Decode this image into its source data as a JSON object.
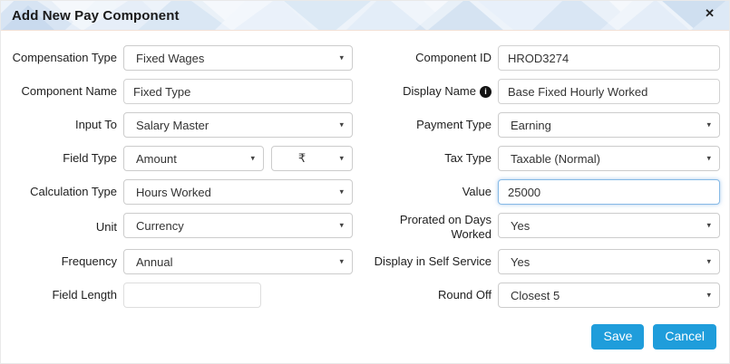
{
  "modal": {
    "title": "Add New Pay Component",
    "close_icon": "✕"
  },
  "icons": {
    "dropdown_caret": "▾",
    "info": "i"
  },
  "form": {
    "left": [
      {
        "label": "Compensation Type",
        "value": "Fixed Wages",
        "type": "select"
      },
      {
        "label": "Component Name",
        "value": "Fixed Type",
        "type": "input"
      },
      {
        "label": "Input To",
        "value": "Salary Master",
        "type": "select"
      },
      {
        "label": "Field Type",
        "value": "Amount",
        "value2": "₹",
        "type": "select-pair"
      },
      {
        "label": "Calculation Type",
        "value": "Hours Worked",
        "type": "select"
      },
      {
        "label": "Unit",
        "value": "Currency",
        "type": "select"
      },
      {
        "label": "Frequency",
        "value": "Annual",
        "type": "select"
      },
      {
        "label": "Field Length",
        "value": "",
        "type": "input"
      }
    ],
    "right": [
      {
        "label": "Component ID",
        "value": "HROD3274",
        "type": "input"
      },
      {
        "label": "Display Name",
        "value": "Base Fixed Hourly Worked",
        "type": "input",
        "has_info_icon": true
      },
      {
        "label": "Payment Type",
        "value": "Earning",
        "type": "select"
      },
      {
        "label": "Tax Type",
        "value": "Taxable (Normal)",
        "type": "select"
      },
      {
        "label": "Value",
        "value": "25000",
        "type": "input",
        "focused": true
      },
      {
        "label": "Prorated on Days Worked",
        "value": "Yes",
        "type": "select"
      },
      {
        "label": "Display in Self Service",
        "value": "Yes",
        "type": "select"
      },
      {
        "label": "Round Off",
        "value": "Closest 5",
        "type": "select"
      }
    ]
  },
  "buttons": {
    "save": "Save",
    "cancel": "Cancel"
  },
  "colors": {
    "accent_button": "#1f9ddb",
    "focus_border": "#85b9e6",
    "header_border": "#f3e1d6",
    "title_text": "#1a1a1a"
  }
}
